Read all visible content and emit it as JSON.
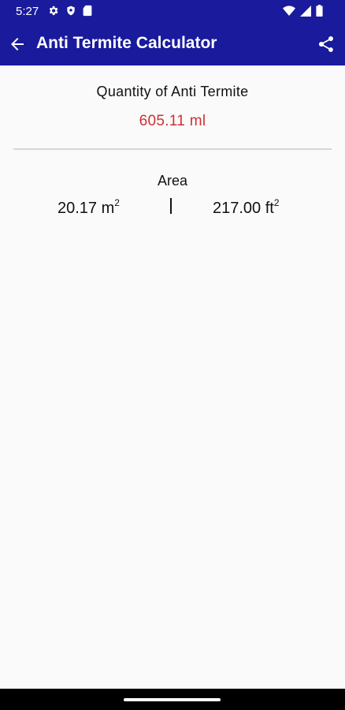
{
  "status_bar": {
    "time": "5:27",
    "left_icons": [
      "gear-icon",
      "shield-icon",
      "sd-card-icon"
    ],
    "right_icons": [
      "wifi-icon",
      "cellular-signal-icon",
      "battery-icon"
    ]
  },
  "toolbar": {
    "title": "Anti Termite Calculator",
    "back_icon": "arrow-left-icon",
    "share_icon": "share-icon",
    "color": "#1a1a9c"
  },
  "result": {
    "label": "Quantity of Anti Termite",
    "value": "605.11 ml",
    "value_color": "#d32f2f"
  },
  "area": {
    "label": "Area",
    "metric_value": "20.17 m",
    "metric_unit_exponent": "2",
    "imperial_value": "217.00 ft",
    "imperial_unit_exponent": "2"
  }
}
